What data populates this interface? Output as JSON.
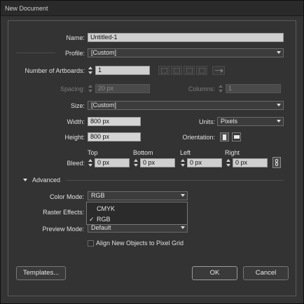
{
  "window": {
    "title": "New Document"
  },
  "name": {
    "label": "Name:",
    "value": "Untitled-1"
  },
  "profile": {
    "label": "Profile:",
    "value": "[Custom]"
  },
  "artboards": {
    "label": "Number of Artboards:",
    "value": "1"
  },
  "spacing": {
    "label": "Spacing:",
    "value": "20 px"
  },
  "columns": {
    "label": "Columns:",
    "value": "1"
  },
  "size": {
    "label": "Size:",
    "value": "[Custom]"
  },
  "width": {
    "label": "Width:",
    "value": "800 px"
  },
  "units": {
    "label": "Units:",
    "value": "Pixels"
  },
  "height": {
    "label": "Height:",
    "value": "800 px"
  },
  "orientation": {
    "label": "Orientation:"
  },
  "bleed": {
    "label": "Bleed:",
    "top_label": "Top",
    "top_value": "0 px",
    "bottom_label": "Bottom",
    "bottom_value": "0 px",
    "left_label": "Left",
    "left_value": "0 px",
    "right_label": "Right",
    "right_value": "0 px"
  },
  "advanced": {
    "label": "Advanced"
  },
  "color_mode": {
    "label": "Color Mode:",
    "value": "RGB",
    "options": [
      "CMYK",
      "RGB"
    ],
    "checkmark": "✓"
  },
  "raster_effects": {
    "label": "Raster Effects:"
  },
  "preview_mode": {
    "label": "Preview Mode:",
    "value": "Default"
  },
  "align_pixel_grid": {
    "label": "Align New Objects to Pixel Grid",
    "checked": false
  },
  "buttons": {
    "templates": "Templates...",
    "ok": "OK",
    "cancel": "Cancel"
  }
}
